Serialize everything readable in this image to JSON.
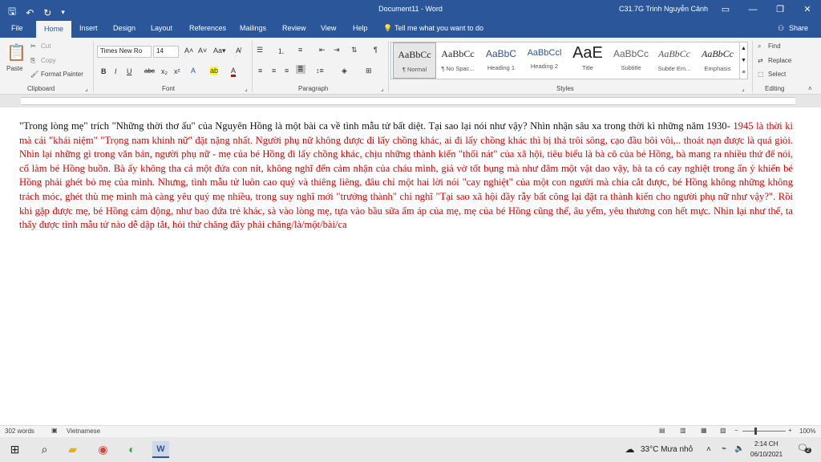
{
  "titlebar": {
    "title": "Document11  -  Word",
    "user": "C31.7G Trinh Nguyễn Cảnh"
  },
  "menu": {
    "tabs": [
      "File",
      "Home",
      "Insert",
      "Design",
      "Layout",
      "References",
      "Mailings",
      "Review",
      "View",
      "Help"
    ],
    "tell_me": "Tell me what you want to do",
    "share": "Share"
  },
  "clipboard": {
    "paste": "Paste",
    "cut": "Cut",
    "copy": "Copy",
    "format_painter": "Format Painter",
    "label": "Clipboard"
  },
  "font": {
    "name": "Times New Ro",
    "size": "14",
    "label": "Font"
  },
  "paragraph": {
    "label": "Paragraph"
  },
  "styles": {
    "label": "Styles",
    "items": [
      {
        "preview": "AaBbCc",
        "name": "¶ Normal"
      },
      {
        "preview": "AaBbCc",
        "name": "¶ No Spac..."
      },
      {
        "preview": "AaBbC",
        "name": "Heading 1"
      },
      {
        "preview": "AaBbCcl",
        "name": "Heading 2"
      },
      {
        "preview": "AaE",
        "name": "Title"
      },
      {
        "preview": "AaBbCc",
        "name": "Subtitle"
      },
      {
        "preview": "AaBbCc",
        "name": "Subtle Em..."
      },
      {
        "preview": "AaBbCc",
        "name": "Emphasis"
      }
    ]
  },
  "editing": {
    "find": "Find",
    "replace": "Replace",
    "select": "Select",
    "label": "Editing"
  },
  "document": {
    "text_black": "\"Trong lòng mẹ\" trích \"Những thời thơ ấu\" của Nguyên Hồng là một bài ca về tình mẫu tử bất diệt. Tại sao lại nói như vậy? Nhìn nhận sâu xa trong thời kì những năm 1930-",
    "text_red": "1945 là thời kì mà cái \"khái niệm\" \"Trọng nam khinh nữ\" đặt nặng nhất. Người phụ nữ không được đi lấy chồng khác, ai đi lấy chồng khác thì bị thả trôi sông, cạo đầu bôi vôi,.. thoát nạn được là quá giỏi. Nhìn lại những gì trong văn bản, người phụ nữ - mẹ của bé Hồng đi lấy chồng khác, chịu những thành kiến \"thối nát\" của xã hội, tiêu biểu là bà cô của bé Hồng, bà mang ra nhiều thứ để nói, cố làm bé Hồng buồn. Bà ấy không tha cả một đứa con nít, không nghĩ đến cảm nhận của cháu mình, giả vờ tốt bụng mà như đâm một vật dao vậy, bà ta có cay nghiệt trong ẩn ý khiến bé Hồng phải ghét bỏ mẹ của mình. Nhưng, tình mẫu tử luôn cao quý và thiêng liêng, đâu chỉ một hai lời nói \"cay nghiệt\" của một con người mà chia cắt được, bé Hồng không những không trách móc, ghét thù mẹ mình mà càng yêu quý mẹ nhiều, trong suy nghĩ mới \"trưởng thành\" chỉ nghĩ \"Tại sao xã hội đầy rẫy bất công lại đặt ra thành kiến cho người phụ nữ như vậy?\". Rồi khi gặp được mẹ, bé Hồng cảm động, như bao đứa trẻ khác, sà vào lòng mẹ, tựa vào bầu sữa ấm áp của mẹ, mẹ của bé Hồng cũng thế, âu yếm, yêu thương con hết mực. Nhìn lại như thế, ta thấy được tình mẫu tử nào dễ dập tắt, hỏi thử chăng đây phải chăng/là/một/bài/ca"
  },
  "status": {
    "words": "302 words",
    "language": "Vietnamese",
    "zoom": "100%"
  },
  "taskbar": {
    "weather": "33°C  Mưa nhỏ",
    "time": "2:14 CH",
    "date": "06/10/2021",
    "notif": "2"
  },
  "colors": {
    "accent": "#2b579a",
    "doc_text_red": "#e00000"
  }
}
